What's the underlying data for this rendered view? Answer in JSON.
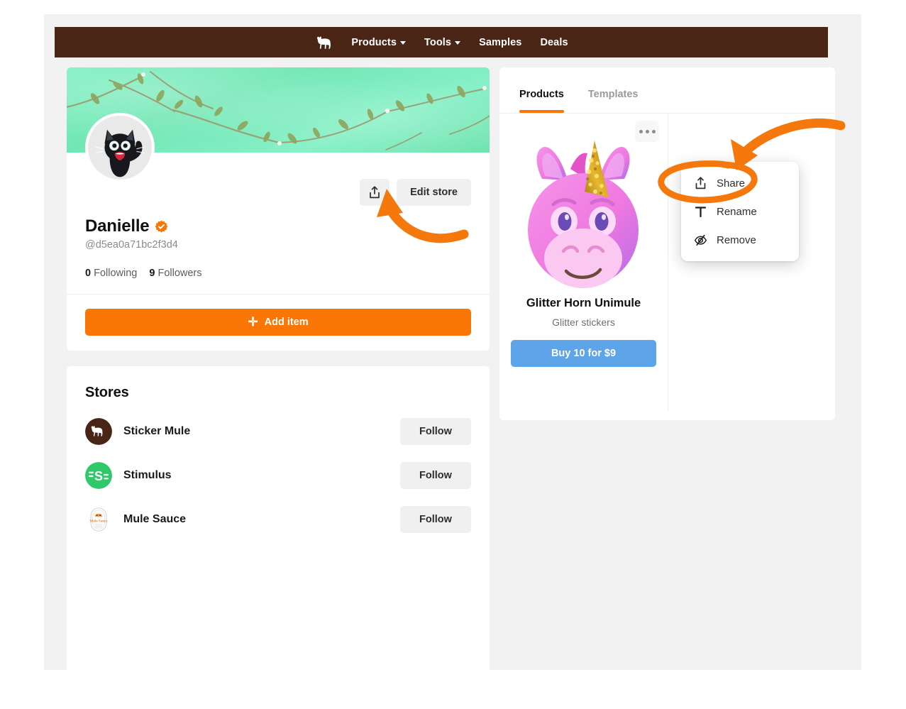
{
  "colors": {
    "brand_brown": "#4a2516",
    "accent_orange": "#f97607",
    "buy_blue": "#5ea4e8",
    "page_gray": "#f2f2f2",
    "banner_mint": "#7ee7b5",
    "annotation_orange": "#f4780c",
    "verified_orange": "#f97607",
    "stimulus_green": "#2fc96a",
    "sticker_mule_brown": "#4a2516"
  },
  "navbar": {
    "logo_icon": "mule-logo-icon",
    "links": [
      {
        "label": "Products",
        "has_dropdown": true,
        "caret_icon": "chevron-down-icon"
      },
      {
        "label": "Tools",
        "has_dropdown": true,
        "caret_icon": "chevron-down-icon"
      },
      {
        "label": "Samples",
        "has_dropdown": false
      },
      {
        "label": "Deals",
        "has_dropdown": false
      }
    ]
  },
  "profile": {
    "banner_image": "mint-green-wall-with-vines",
    "avatar_image": "black-cat-jiji-avatar",
    "display_name": "Danielle",
    "verified_icon": "verified-check-badge-icon",
    "handle": "@d5ea0a71bc2f3d4",
    "following_count": "0",
    "following_label": "Following",
    "followers_count": "9",
    "followers_label": "Followers",
    "share_button": {
      "label": "",
      "icon": "share-upload-icon"
    },
    "edit_store_button": {
      "label": "Edit store"
    },
    "add_item_button": {
      "label": "Add item",
      "icon": "plus-icon"
    }
  },
  "stores": {
    "title": "Stores",
    "items": [
      {
        "name": "Sticker Mule",
        "avatar_icon": "sticker-mule-logo-icon",
        "follow_label": "Follow"
      },
      {
        "name": "Stimulus",
        "avatar_icon": "stimulus-logo-icon",
        "follow_label": "Follow"
      },
      {
        "name": "Mule Sauce",
        "avatar_icon": "mule-sauce-logo-icon",
        "follow_label": "Follow"
      }
    ]
  },
  "catalog": {
    "tabs": [
      {
        "label": "Products",
        "active": true
      },
      {
        "label": "Templates",
        "active": false
      }
    ],
    "product": {
      "image": "pink-unicorn-mule-glitter-horn-sticker",
      "title": "Glitter Horn Unimule",
      "subtitle": "Glitter stickers",
      "buy_label": "Buy 10 for $9",
      "overflow_button": {
        "icon": "ellipsis-horizontal-icon"
      }
    }
  },
  "context_menu": {
    "items": [
      {
        "label": "Share",
        "icon": "share-upload-icon"
      },
      {
        "label": "Rename",
        "icon": "text-t-icon"
      },
      {
        "label": "Remove",
        "icon": "eye-slash-icon"
      }
    ]
  },
  "annotations": [
    {
      "name": "arrow-to-share-button",
      "type": "curved-arrow",
      "color": "#f4780c",
      "points_at": "profile share button"
    },
    {
      "name": "arrow-to-share-menu-item",
      "type": "curved-arrow",
      "color": "#f4780c",
      "points_at": "Share menu item"
    },
    {
      "name": "ellipse-around-share-menu-item",
      "type": "ellipse",
      "color": "#f4780c",
      "encircles": "Share menu item"
    }
  ]
}
